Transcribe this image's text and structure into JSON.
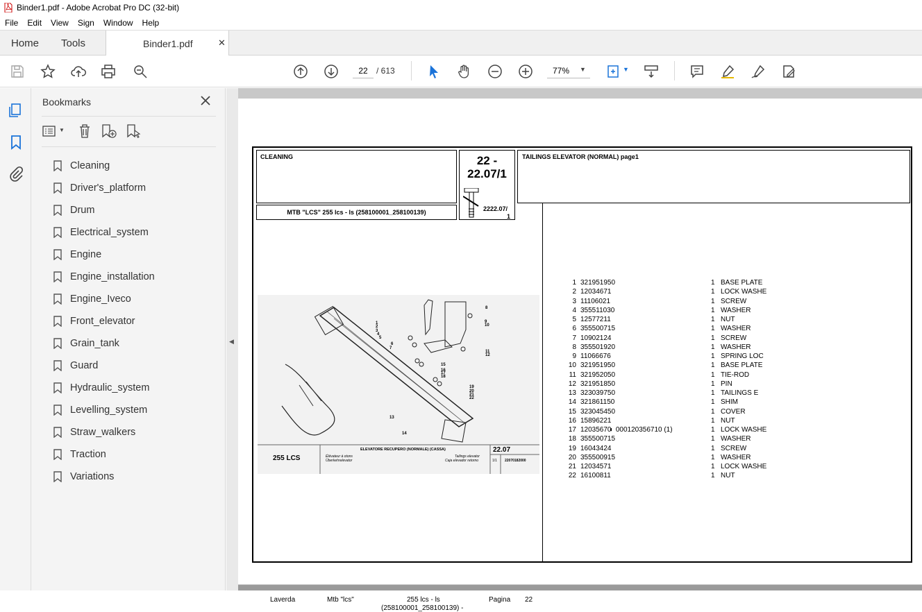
{
  "window": {
    "title": "Binder1.pdf - Adobe Acrobat Pro DC (32-bit)"
  },
  "menu": [
    "File",
    "Edit",
    "View",
    "Sign",
    "Window",
    "Help"
  ],
  "tabs": {
    "home": "Home",
    "tools": "Tools",
    "document": "Binder1.pdf"
  },
  "toolbar": {
    "page_current": "22",
    "page_total": "/ 613",
    "zoom": "77%"
  },
  "bookmarks": {
    "title": "Bookmarks",
    "items": [
      "Cleaning",
      "Driver's_platform",
      "Drum",
      "Electrical_system",
      "Engine",
      "Engine_installation",
      "Engine_Iveco",
      "Front_elevator",
      "Grain_tank",
      "Guard",
      "Hydraulic_system",
      "Levelling_system",
      "Straw_walkers",
      "Traction",
      "Variations"
    ]
  },
  "doc": {
    "section": "CLEANING",
    "code_line1": "22 -",
    "code_line2": "22.07/1",
    "small_code": "2222.07/",
    "small_code2": "1",
    "model": "MTB \"LCS\" 255 lcs - ls (258100001_258100139)",
    "heading": "TAILINGS ELEVATOR (NORMAL)  page1",
    "figure": {
      "model": "255 LCS",
      "title": "ELEVATORE RECUPERO (NORMALE) (CASSA)",
      "sub_left1": "Élévateur à otons",
      "sub_left2": "Überkehrelevator",
      "sub_right1": "Tailings elevator",
      "sub_right2": "Caja elevador retorno",
      "code": "22.07",
      "page": "1/1",
      "ref": "22070182000"
    },
    "parts": [
      {
        "n": "1",
        "code": "321951950",
        "extra": "",
        "qty": "1",
        "desc": "BASE PLATE"
      },
      {
        "n": "2",
        "code": "12034671",
        "extra": "",
        "qty": "1",
        "desc": "LOCK WASHE"
      },
      {
        "n": "3",
        "code": "11106021",
        "extra": "",
        "qty": "1",
        "desc": "SCREW"
      },
      {
        "n": "4",
        "code": "355511030",
        "extra": "",
        "qty": "1",
        "desc": "WASHER"
      },
      {
        "n": "5",
        "code": "12577211",
        "extra": "",
        "qty": "1",
        "desc": "NUT"
      },
      {
        "n": "6",
        "code": "355500715",
        "extra": "",
        "qty": "1",
        "desc": "WASHER"
      },
      {
        "n": "7",
        "code": "10902124",
        "extra": "",
        "qty": "1",
        "desc": "SCREW"
      },
      {
        "n": "8",
        "code": "355501920",
        "extra": "",
        "qty": "1",
        "desc": "WASHER"
      },
      {
        "n": "9",
        "code": "11066676",
        "extra": "",
        "qty": "1",
        "desc": "SPRING LOC"
      },
      {
        "n": "10",
        "code": "321951950",
        "extra": "",
        "qty": "1",
        "desc": "BASE PLATE"
      },
      {
        "n": "11",
        "code": "321952050",
        "extra": "",
        "qty": "1",
        "desc": "TIE-ROD"
      },
      {
        "n": "12",
        "code": "321951850",
        "extra": "",
        "qty": "1",
        "desc": "PIN"
      },
      {
        "n": "13",
        "code": "323039750",
        "extra": "",
        "qty": "1",
        "desc": "TAILINGS E"
      },
      {
        "n": "14",
        "code": "321861150",
        "extra": "",
        "qty": "1",
        "desc": "SHIM"
      },
      {
        "n": "15",
        "code": "323045450",
        "extra": "",
        "qty": "1",
        "desc": "COVER"
      },
      {
        "n": "16",
        "code": "15896221",
        "extra": "",
        "qty": "1",
        "desc": "NUT"
      },
      {
        "n": "17",
        "code": "12035670",
        "extra": "000120356710  (1)",
        "qty": "1",
        "desc": "LOCK WASHE"
      },
      {
        "n": "18",
        "code": "355500715",
        "extra": "",
        "qty": "1",
        "desc": "WASHER"
      },
      {
        "n": "19",
        "code": "16043424",
        "extra": "",
        "qty": "1",
        "desc": "SCREW"
      },
      {
        "n": "20",
        "code": "355500915",
        "extra": "",
        "qty": "1",
        "desc": "WASHER"
      },
      {
        "n": "21",
        "code": "12034571",
        "extra": "",
        "qty": "1",
        "desc": "LOCK WASHE"
      },
      {
        "n": "22",
        "code": "16100811",
        "extra": "",
        "qty": "1",
        "desc": "NUT"
      }
    ],
    "footer": {
      "brand": "Laverda",
      "mtb": "Mtb \"lcs\"",
      "model1": "255 lcs - ls",
      "model2": "(258100001_258100139) -",
      "pagina": "Pagina",
      "page": "22"
    }
  }
}
